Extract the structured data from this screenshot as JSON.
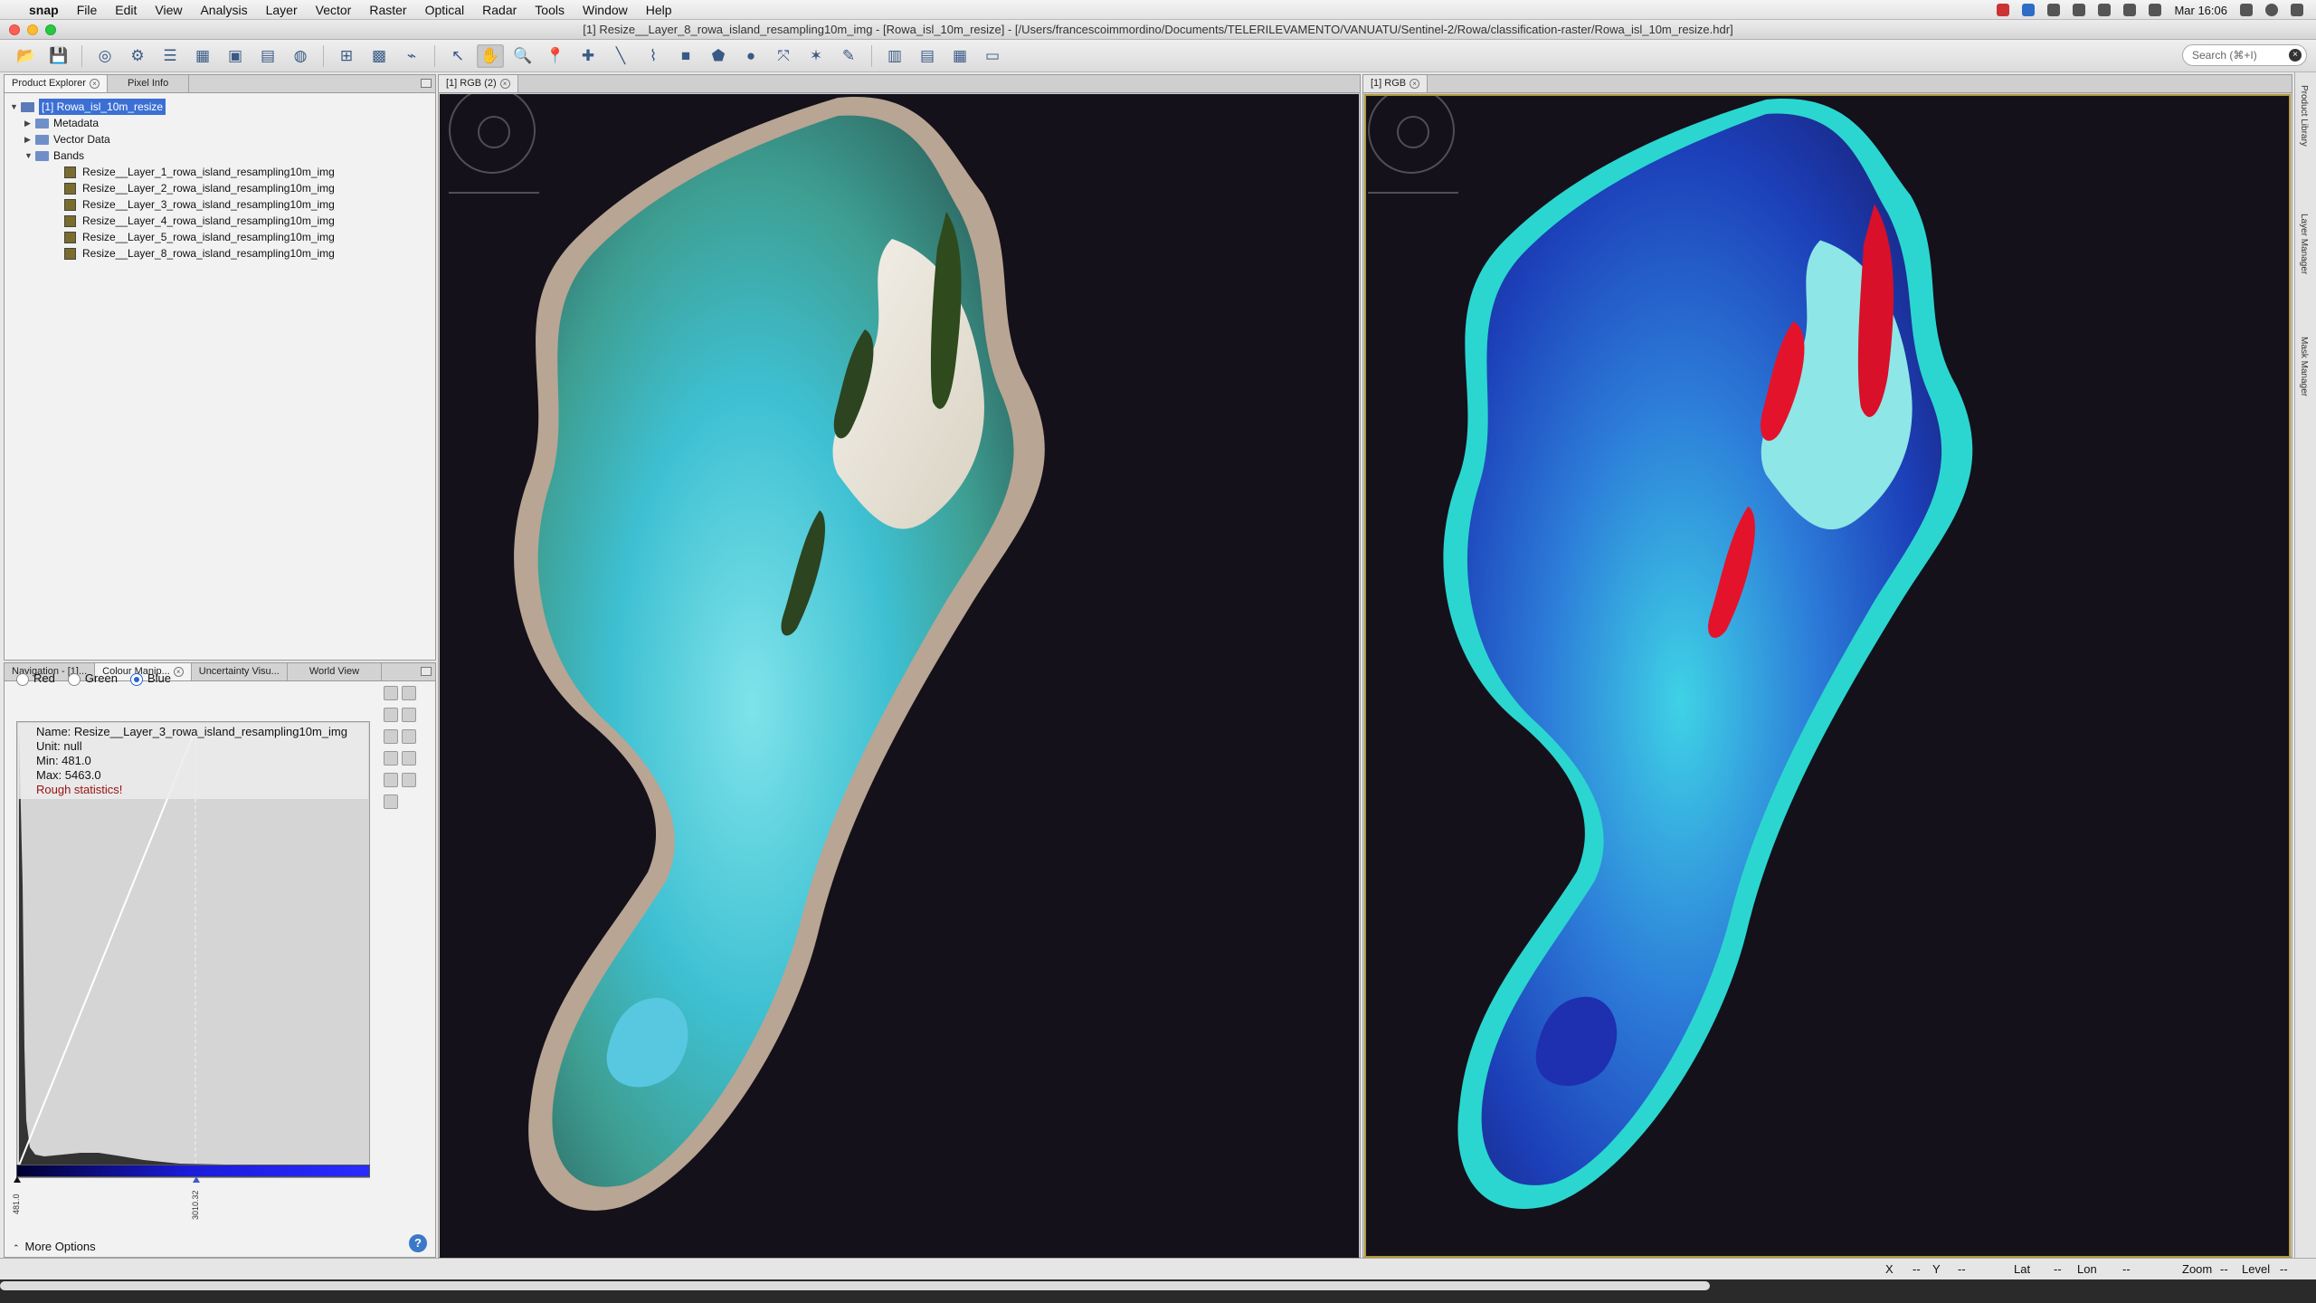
{
  "menubar": {
    "app": "snap",
    "items": [
      "File",
      "Edit",
      "View",
      "Analysis",
      "Layer",
      "Vector",
      "Raster",
      "Optical",
      "Radar",
      "Tools",
      "Window",
      "Help"
    ],
    "clock": "Mar 16:06"
  },
  "window": {
    "title": "[1] Resize__Layer_8_rowa_island_resampling10m_img - [Rowa_isl_10m_resize] - [/Users/francescoimmordino/Documents/TELERILEVAMENTO/VANUATU/Sentinel-2/Rowa/classification-raster/Rowa_isl_10m_resize.hdr]"
  },
  "toolbar": {
    "search_placeholder": "Search (⌘+I)",
    "icons": [
      "open-product-icon",
      "save-product-icon",
      "session-icon",
      "graph-builder-icon",
      "batch-icon",
      "pixel-info-icon",
      "subset-icon",
      "reprojection-icon",
      "globe-icon",
      "band-maths-icon",
      "mosaic-icon",
      "time-series-icon",
      "select-tool-icon",
      "pan-tool-icon",
      "zoom-tool-icon",
      "pin-tool-icon",
      "gcp-tool-icon",
      "line-tool-icon",
      "polyline-tool-icon",
      "rectangle-tool-icon",
      "polygon-tool-icon",
      "ellipse-tool-icon",
      "range-finder-icon",
      "magic-wand-icon",
      "measure-icon",
      "tile-horizontal-icon",
      "tile-vertical-icon",
      "tile-grid-icon",
      "tile-evenly-icon"
    ]
  },
  "product_explorer": {
    "tabs": [
      "Product Explorer",
      "Pixel Info"
    ],
    "product": "[1] Rowa_isl_10m_resize",
    "folders": [
      "Metadata",
      "Vector Data",
      "Bands"
    ],
    "bands": [
      "Resize__Layer_1_rowa_island_resampling10m_img",
      "Resize__Layer_2_rowa_island_resampling10m_img",
      "Resize__Layer_3_rowa_island_resampling10m_img",
      "Resize__Layer_4_rowa_island_resampling10m_img",
      "Resize__Layer_5_rowa_island_resampling10m_img",
      "Resize__Layer_8_rowa_island_resampling10m_img"
    ]
  },
  "colour_panel": {
    "tabs": [
      "Navigation - [1]...",
      "Colour Manip...",
      "Uncertainty Visu...",
      "World View"
    ],
    "channels": [
      "Red",
      "Green",
      "Blue"
    ],
    "selected_channel": "Blue",
    "info": {
      "name": "Name: Resize__Layer_3_rowa_island_resampling10m_img",
      "unit": "Unit: null",
      "min": "Min: 481.0",
      "max": "Max: 5463.0",
      "warning": "Rough statistics!"
    },
    "tick_min": "481.0",
    "tick_mid": "3010.32",
    "more_options": "More Options"
  },
  "views": {
    "left_tab": "[1] RGB (2)",
    "right_tab": "[1] RGB"
  },
  "right_strip": [
    "Product Library",
    "Layer Manager",
    "Mask Manager"
  ],
  "statusbar": {
    "x": "X",
    "x_val": "--",
    "y": "Y",
    "y_val": "--",
    "lat": "Lat",
    "lat_val": "--",
    "lon": "Lon",
    "lon_val": "--",
    "zoom": "Zoom",
    "zoom_val": "--",
    "level": "Level",
    "level_val": "--"
  },
  "colors": {
    "accent": "#2a62d6",
    "view_bg": "#14111a",
    "colorbar_blue": "#2a2aff"
  }
}
